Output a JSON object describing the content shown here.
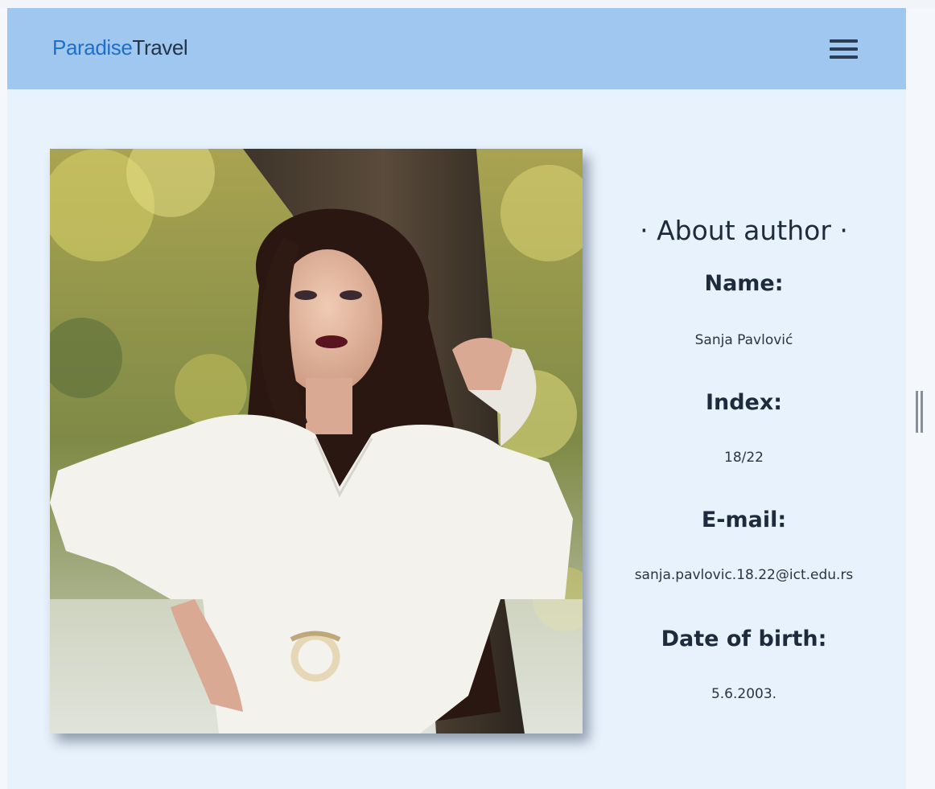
{
  "navbar": {
    "brand_part1": "Paradise",
    "brand_part2": "Travel",
    "menu_icon": "hamburger-menu-icon"
  },
  "author": {
    "heading": "· About author ·",
    "name_label": "Name:",
    "name_value": "Sanja Pavlović",
    "index_label": "Index:",
    "index_value": "18/22",
    "email_label": "E-mail:",
    "email_value": "sanja.pavlovic.18.22@ict.edu.rs",
    "dob_label": "Date of birth:",
    "dob_value": "5.6.2003."
  },
  "colors": {
    "navbar_bg": "#9fc7ef",
    "page_bg": "#e8f2fc",
    "brand_accent": "#1f6fc9",
    "text_dark": "#1d2b3c"
  }
}
